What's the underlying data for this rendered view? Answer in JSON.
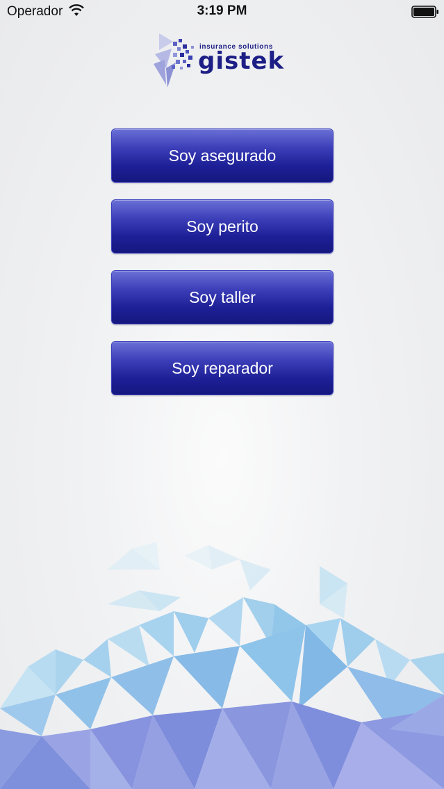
{
  "status_bar": {
    "carrier": "Operador",
    "time": "3:19 PM",
    "wifi_icon": "wifi-icon",
    "battery_icon": "battery-full-icon"
  },
  "logo": {
    "tagline": "insurance solutions",
    "wordmark": "gistek",
    "brand_color": "#1d1f86"
  },
  "menu": {
    "buttons": [
      {
        "label": "Soy asegurado"
      },
      {
        "label": "Soy perito"
      },
      {
        "label": "Soy taller"
      },
      {
        "label": "Soy reparador"
      }
    ],
    "button_color": "#1d1f96"
  },
  "background": {
    "pattern": "low-poly-triangles",
    "colors": [
      "#a9d8f0",
      "#7fc2ec",
      "#8d96e0",
      "#b9a9ec"
    ]
  }
}
